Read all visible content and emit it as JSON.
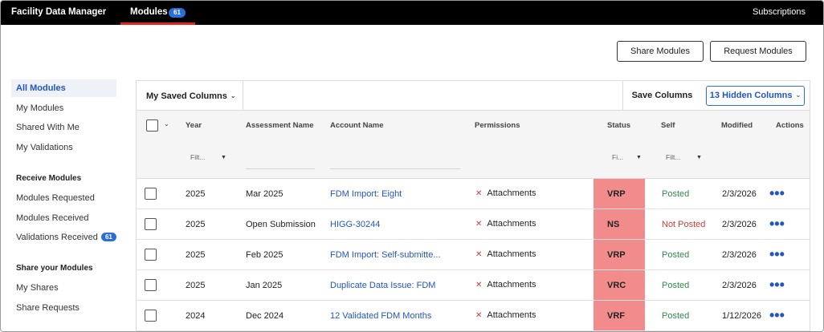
{
  "topbar": {
    "brand": "Facility Data Manager",
    "modules_tab": "Modules",
    "modules_badge": "61",
    "subscriptions": "Subscriptions"
  },
  "actions": {
    "share": "Share Modules",
    "request": "Request Modules"
  },
  "sidebar": {
    "items": [
      {
        "label": "All Modules"
      },
      {
        "label": "My Modules"
      },
      {
        "label": "Shared With Me"
      },
      {
        "label": "My Validations"
      }
    ],
    "receive_heading": "Receive Modules",
    "receive_items": [
      {
        "label": "Modules Requested"
      },
      {
        "label": "Modules Received"
      },
      {
        "label": "Validations Received",
        "badge": "61"
      }
    ],
    "share_heading": "Share your Modules",
    "share_items": [
      {
        "label": "My Shares"
      },
      {
        "label": "Share Requests"
      }
    ]
  },
  "toolbar": {
    "saved_columns": "My Saved Columns",
    "save_columns": "Save Columns",
    "hidden_columns": "13 Hidden Columns"
  },
  "columns": {
    "year": "Year",
    "assessment": "Assessment Name",
    "account": "Account Name",
    "permissions": "Permissions",
    "status": "Status",
    "self": "Self",
    "modified": "Modified",
    "actions": "Actions"
  },
  "filters": {
    "year": "Filt...",
    "status": "Fi...",
    "self": "Filt..."
  },
  "rows": [
    {
      "year": "2025",
      "assessment": "Mar 2025",
      "account": "FDM Import: Eight",
      "permissions": "Attachments",
      "status": "VRP",
      "self": "Posted",
      "modified": "2/3/2026"
    },
    {
      "year": "2025",
      "assessment": "Open Submission",
      "account": "HIGG-30244",
      "permissions": "Attachments",
      "status": "NS",
      "self": "Not Posted",
      "modified": "2/3/2026"
    },
    {
      "year": "2025",
      "assessment": "Feb 2025",
      "account": "FDM Import: Self-submitte...",
      "permissions": "Attachments",
      "status": "VRP",
      "self": "Posted",
      "modified": "2/3/2026"
    },
    {
      "year": "2025",
      "assessment": "Jan 2025",
      "account": "Duplicate Data Issue: FDM",
      "permissions": "Attachments",
      "status": "VRC",
      "self": "Posted",
      "modified": "2/3/2026"
    },
    {
      "year": "2024",
      "assessment": "Dec 2024",
      "account": "12 Validated FDM Months",
      "permissions": "Attachments",
      "status": "VRF",
      "self": "Posted",
      "modified": "1/12/2026"
    }
  ],
  "colors": {
    "accent": "#2b6fd6",
    "status_highlight": "#f28c8c",
    "posted": "#2f8a4c",
    "not_posted": "#d23b3b",
    "tab_underline": "#e0261f"
  }
}
